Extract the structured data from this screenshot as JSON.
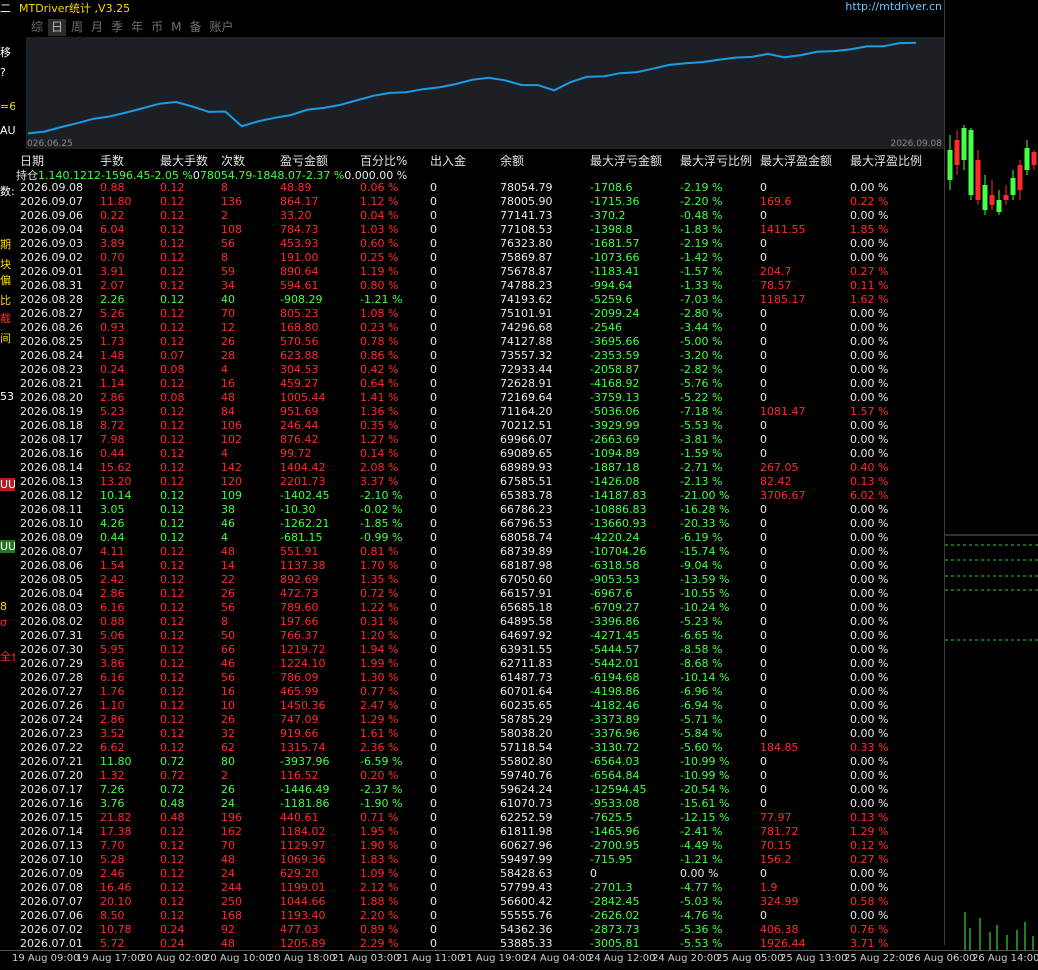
{
  "app": {
    "title": "MTDriver统计 ,V3.25",
    "url": "http://mtdriver.cn"
  },
  "tabs": [
    {
      "label": "综",
      "active": false
    },
    {
      "label": "日",
      "active": true
    },
    {
      "label": "周",
      "active": false
    },
    {
      "label": "月",
      "active": false
    },
    {
      "label": "季",
      "active": false
    },
    {
      "label": "年",
      "active": false
    },
    {
      "label": "币",
      "active": false
    },
    {
      "label": "M",
      "active": false
    },
    {
      "label": "备",
      "active": false
    },
    {
      "label": "账户",
      "active": false
    }
  ],
  "equity_chart": {
    "start_date": "026.06.25",
    "end_date": "2026.09.08",
    "line_color": "#1e9be6"
  },
  "table": {
    "headers": [
      "日期",
      "手数",
      "最大手数",
      "次数",
      "盈亏金额",
      "百分比%",
      "出入金",
      "余额",
      "最大浮亏金额",
      "最大浮亏比例",
      "最大浮盈金额",
      "最大浮盈比例"
    ],
    "holding": [
      "持仓",
      "1.14",
      "0.12",
      "12",
      "-1596.45",
      "-2.05 %",
      "0",
      "78054.79",
      "-1848.07",
      "-2.37 %",
      "0.00",
      "0.00 %"
    ],
    "rows": [
      [
        "2026.09.08",
        "0.88",
        "0.12",
        "8",
        "48.89",
        "0.06 %",
        "0",
        "78054.79",
        "-1708.6",
        "-2.19 %",
        "0",
        "0.00 %"
      ],
      [
        "2026.09.07",
        "11.80",
        "0.12",
        "136",
        "864.17",
        "1.12 %",
        "0",
        "78005.90",
        "-1715.36",
        "-2.20 %",
        "169.6",
        "0.22 %"
      ],
      [
        "2026.09.06",
        "0.22",
        "0.12",
        "2",
        "33.20",
        "0.04 %",
        "0",
        "77141.73",
        "-370.2",
        "-0.48 %",
        "0",
        "0.00 %"
      ],
      [
        "2026.09.04",
        "6.04",
        "0.12",
        "108",
        "784.73",
        "1.03 %",
        "0",
        "77108.53",
        "-1398.8",
        "-1.83 %",
        "1411.55",
        "1.85 %"
      ],
      [
        "2026.09.03",
        "3.89",
        "0.12",
        "56",
        "453.93",
        "0.60 %",
        "0",
        "76323.80",
        "-1681.57",
        "-2.19 %",
        "0",
        "0.00 %"
      ],
      [
        "2026.09.02",
        "0.70",
        "0.12",
        "8",
        "191.00",
        "0.25 %",
        "0",
        "75869.87",
        "-1073.66",
        "-1.42 %",
        "0",
        "0.00 %"
      ],
      [
        "2026.09.01",
        "3.91",
        "0.12",
        "59",
        "890.64",
        "1.19 %",
        "0",
        "75678.87",
        "-1183.41",
        "-1.57 %",
        "204.7",
        "0.27 %"
      ],
      [
        "2026.08.31",
        "2.07",
        "0.12",
        "34",
        "594.61",
        "0.80 %",
        "0",
        "74788.23",
        "-994.64",
        "-1.33 %",
        "78.57",
        "0.11 %"
      ],
      [
        "2026.08.28",
        "2.26",
        "0.12",
        "40",
        "-908.29",
        "-1.21 %",
        "0",
        "74193.62",
        "-5259.6",
        "-7.03 %",
        "1185.17",
        "1.62 %"
      ],
      [
        "2026.08.27",
        "5.26",
        "0.12",
        "70",
        "805.23",
        "1.08 %",
        "0",
        "75101.91",
        "-2099.24",
        "-2.80 %",
        "0",
        "0.00 %"
      ],
      [
        "2026.08.26",
        "0.93",
        "0.12",
        "12",
        "168.80",
        "0.23 %",
        "0",
        "74296.68",
        "-2546",
        "-3.44 %",
        "0",
        "0.00 %"
      ],
      [
        "2026.08.25",
        "1.73",
        "0.12",
        "26",
        "570.56",
        "0.78 %",
        "0",
        "74127.88",
        "-3695.66",
        "-5.00 %",
        "0",
        "0.00 %"
      ],
      [
        "2026.08.24",
        "1.48",
        "0.07",
        "28",
        "623.88",
        "0.86 %",
        "0",
        "73557.32",
        "-2353.59",
        "-3.20 %",
        "0",
        "0.00 %"
      ],
      [
        "2026.08.23",
        "0.24",
        "0.08",
        "4",
        "304.53",
        "0.42 %",
        "0",
        "72933.44",
        "-2058.87",
        "-2.82 %",
        "0",
        "0.00 %"
      ],
      [
        "2026.08.21",
        "1.14",
        "0.12",
        "16",
        "459.27",
        "0.64 %",
        "0",
        "72628.91",
        "-4168.92",
        "-5.76 %",
        "0",
        "0.00 %"
      ],
      [
        "2026.08.20",
        "2.86",
        "0.08",
        "48",
        "1005.44",
        "1.41 %",
        "0",
        "72169.64",
        "-3759.13",
        "-5.22 %",
        "0",
        "0.00 %"
      ],
      [
        "2026.08.19",
        "5.23",
        "0.12",
        "84",
        "951.69",
        "1.36 %",
        "0",
        "71164.20",
        "-5036.06",
        "-7.18 %",
        "1081.47",
        "1.57 %"
      ],
      [
        "2026.08.18",
        "8.72",
        "0.12",
        "106",
        "246.44",
        "0.35 %",
        "0",
        "70212.51",
        "-3929.99",
        "-5.53 %",
        "0",
        "0.00 %"
      ],
      [
        "2026.08.17",
        "7.98",
        "0.12",
        "102",
        "876.42",
        "1.27 %",
        "0",
        "69966.07",
        "-2663.69",
        "-3.81 %",
        "0",
        "0.00 %"
      ],
      [
        "2026.08.16",
        "0.44",
        "0.12",
        "4",
        "99.72",
        "0.14 %",
        "0",
        "69089.65",
        "-1094.89",
        "-1.59 %",
        "0",
        "0.00 %"
      ],
      [
        "2026.08.14",
        "15.62",
        "0.12",
        "142",
        "1404.42",
        "2.08 %",
        "0",
        "68989.93",
        "-1887.18",
        "-2.71 %",
        "267.05",
        "0.40 %"
      ],
      [
        "2026.08.13",
        "13.20",
        "0.12",
        "120",
        "2201.73",
        "3.37 %",
        "0",
        "67585.51",
        "-1426.08",
        "-2.13 %",
        "82.42",
        "0.13 %"
      ],
      [
        "2026.08.12",
        "10.14",
        "0.12",
        "109",
        "-1402.45",
        "-2.10 %",
        "0",
        "65383.78",
        "-14187.83",
        "-21.00 %",
        "3706.67",
        "6.02 %"
      ],
      [
        "2026.08.11",
        "3.05",
        "0.12",
        "38",
        "-10.30",
        "-0.02 %",
        "0",
        "66786.23",
        "-10886.83",
        "-16.28 %",
        "0",
        "0.00 %"
      ],
      [
        "2026.08.10",
        "4.26",
        "0.12",
        "46",
        "-1262.21",
        "-1.85 %",
        "0",
        "66796.53",
        "-13660.93",
        "-20.33 %",
        "0",
        "0.00 %"
      ],
      [
        "2026.08.09",
        "0.44",
        "0.12",
        "4",
        "-681.15",
        "-0.99 %",
        "0",
        "68058.74",
        "-4220.24",
        "-6.19 %",
        "0",
        "0.00 %"
      ],
      [
        "2026.08.07",
        "4.11",
        "0.12",
        "48",
        "551.91",
        "0.81 %",
        "0",
        "68739.89",
        "-10704.26",
        "-15.74 %",
        "0",
        "0.00 %"
      ],
      [
        "2026.08.06",
        "1.54",
        "0.12",
        "14",
        "1137.38",
        "1.70 %",
        "0",
        "68187.98",
        "-6318.58",
        "-9.04 %",
        "0",
        "0.00 %"
      ],
      [
        "2026.08.05",
        "2.42",
        "0.12",
        "22",
        "892.69",
        "1.35 %",
        "0",
        "67050.60",
        "-9053.53",
        "-13.59 %",
        "0",
        "0.00 %"
      ],
      [
        "2026.08.04",
        "2.86",
        "0.12",
        "26",
        "472.73",
        "0.72 %",
        "0",
        "66157.91",
        "-6967.6",
        "-10.55 %",
        "0",
        "0.00 %"
      ],
      [
        "2026.08.03",
        "6.16",
        "0.12",
        "56",
        "789.60",
        "1.22 %",
        "0",
        "65685.18",
        "-6709.27",
        "-10.24 %",
        "0",
        "0.00 %"
      ],
      [
        "2026.08.02",
        "0.88",
        "0.12",
        "8",
        "197.66",
        "0.31 %",
        "0",
        "64895.58",
        "-3396.86",
        "-5.23 %",
        "0",
        "0.00 %"
      ],
      [
        "2026.07.31",
        "5.06",
        "0.12",
        "50",
        "766.37",
        "1.20 %",
        "0",
        "64697.92",
        "-4271.45",
        "-6.65 %",
        "0",
        "0.00 %"
      ],
      [
        "2026.07.30",
        "5.95",
        "0.12",
        "66",
        "1219.72",
        "1.94 %",
        "0",
        "63931.55",
        "-5444.57",
        "-8.58 %",
        "0",
        "0.00 %"
      ],
      [
        "2026.07.29",
        "3.86",
        "0.12",
        "46",
        "1224.10",
        "1.99 %",
        "0",
        "62711.83",
        "-5442.01",
        "-8.68 %",
        "0",
        "0.00 %"
      ],
      [
        "2026.07.28",
        "6.16",
        "0.12",
        "56",
        "786.09",
        "1.30 %",
        "0",
        "61487.73",
        "-6194.68",
        "-10.14 %",
        "0",
        "0.00 %"
      ],
      [
        "2026.07.27",
        "1.76",
        "0.12",
        "16",
        "465.99",
        "0.77 %",
        "0",
        "60701.64",
        "-4198.86",
        "-6.96 %",
        "0",
        "0.00 %"
      ],
      [
        "2026.07.26",
        "1.10",
        "0.12",
        "10",
        "1450.36",
        "2.47 %",
        "0",
        "60235.65",
        "-4182.46",
        "-6.94 %",
        "0",
        "0.00 %"
      ],
      [
        "2026.07.24",
        "2.86",
        "0.12",
        "26",
        "747.09",
        "1.29 %",
        "0",
        "58785.29",
        "-3373.89",
        "-5.71 %",
        "0",
        "0.00 %"
      ],
      [
        "2026.07.23",
        "3.52",
        "0.12",
        "32",
        "919.66",
        "1.61 %",
        "0",
        "58038.20",
        "-3376.96",
        "-5.84 %",
        "0",
        "0.00 %"
      ],
      [
        "2026.07.22",
        "6.62",
        "0.12",
        "62",
        "1315.74",
        "2.36 %",
        "0",
        "57118.54",
        "-3130.72",
        "-5.60 %",
        "184.85",
        "0.33 %"
      ],
      [
        "2026.07.21",
        "11.80",
        "0.72",
        "80",
        "-3937.96",
        "-6.59 %",
        "0",
        "55802.80",
        "-6564.03",
        "-10.99 %",
        "0",
        "0.00 %"
      ],
      [
        "2026.07.20",
        "1.32",
        "0.72",
        "2",
        "116.52",
        "0.20 %",
        "0",
        "59740.76",
        "-6564.84",
        "-10.99 %",
        "0",
        "0.00 %"
      ],
      [
        "2026.07.17",
        "7.26",
        "0.72",
        "26",
        "-1446.49",
        "-2.37 %",
        "0",
        "59624.24",
        "-12594.45",
        "-20.54 %",
        "0",
        "0.00 %"
      ],
      [
        "2026.07.16",
        "3.76",
        "0.48",
        "24",
        "-1181.86",
        "-1.90 %",
        "0",
        "61070.73",
        "-9533.08",
        "-15.61 %",
        "0",
        "0.00 %"
      ],
      [
        "2026.07.15",
        "21.82",
        "0.48",
        "196",
        "440.61",
        "0.71 %",
        "0",
        "62252.59",
        "-7625.5",
        "-12.15 %",
        "77.97",
        "0.13 %"
      ],
      [
        "2026.07.14",
        "17.38",
        "0.12",
        "162",
        "1184.02",
        "1.95 %",
        "0",
        "61811.98",
        "-1465.96",
        "-2.41 %",
        "781.72",
        "1.29 %"
      ],
      [
        "2026.07.13",
        "7.70",
        "0.12",
        "70",
        "1129.97",
        "1.90 %",
        "0",
        "60627.96",
        "-2700.95",
        "-4.49 %",
        "70.15",
        "0.12 %"
      ],
      [
        "2026.07.10",
        "5.28",
        "0.12",
        "48",
        "1069.36",
        "1.83 %",
        "0",
        "59497.99",
        "-715.95",
        "-1.21 %",
        "156.2",
        "0.27 %"
      ],
      [
        "2026.07.09",
        "2.46",
        "0.12",
        "24",
        "629.20",
        "1.09 %",
        "0",
        "58428.63",
        "0",
        "0.00 %",
        "0",
        "0.00 %"
      ],
      [
        "2026.07.08",
        "16.46",
        "0.12",
        "244",
        "1199.01",
        "2.12 %",
        "0",
        "57799.43",
        "-2701.3",
        "-4.77 %",
        "1.9",
        "0.00 %"
      ],
      [
        "2026.07.07",
        "20.10",
        "0.12",
        "250",
        "1044.66",
        "1.88 %",
        "0",
        "56600.42",
        "-2842.45",
        "-5.03 %",
        "324.99",
        "0.58 %"
      ],
      [
        "2026.07.06",
        "8.50",
        "0.12",
        "168",
        "1193.40",
        "2.20 %",
        "0",
        "55555.76",
        "-2626.02",
        "-4.76 %",
        "0",
        "0.00 %"
      ],
      [
        "2026.07.02",
        "10.78",
        "0.24",
        "92",
        "477.03",
        "0.89 %",
        "0",
        "54362.36",
        "-2873.73",
        "-5.36 %",
        "406.38",
        "0.76 %"
      ],
      [
        "2026.07.01",
        "5.72",
        "0.24",
        "48",
        "1205.89",
        "2.29 %",
        "0",
        "53885.33",
        "-3005.81",
        "-5.53 %",
        "1926.44",
        "3.71 %"
      ]
    ]
  },
  "left_strip": [
    "二",
    "移",
    "",
    "?",
    "=6",
    "AU",
    "数:",
    "期",
    "块",
    "偏",
    "比",
    "截",
    "间",
    "53",
    "UU",
    "UU",
    "8",
    "σ",
    "全仓"
  ],
  "time_axis": [
    "19 Aug 09:00",
    "19 Aug 17:00",
    "20 Aug 02:00",
    "20 Aug 10:00",
    "20 Aug 18:00",
    "21 Aug 03:00",
    "21 Aug 11:00",
    "21 Aug 19:00",
    "24 Aug 04:00",
    "24 Aug 12:00",
    "24 Aug 20:00",
    "25 Aug 05:00",
    "25 Aug 13:00",
    "25 Aug 22:00",
    "26 Aug 06:00",
    "26 Aug 14:00"
  ],
  "colors": {
    "profit": "#ff2b2b",
    "loss": "#44ff44",
    "bull_candle": "#44ff44",
    "bear_candle": "#ff2b2b",
    "title": "#ffd700",
    "url": "#6cc6ff"
  }
}
